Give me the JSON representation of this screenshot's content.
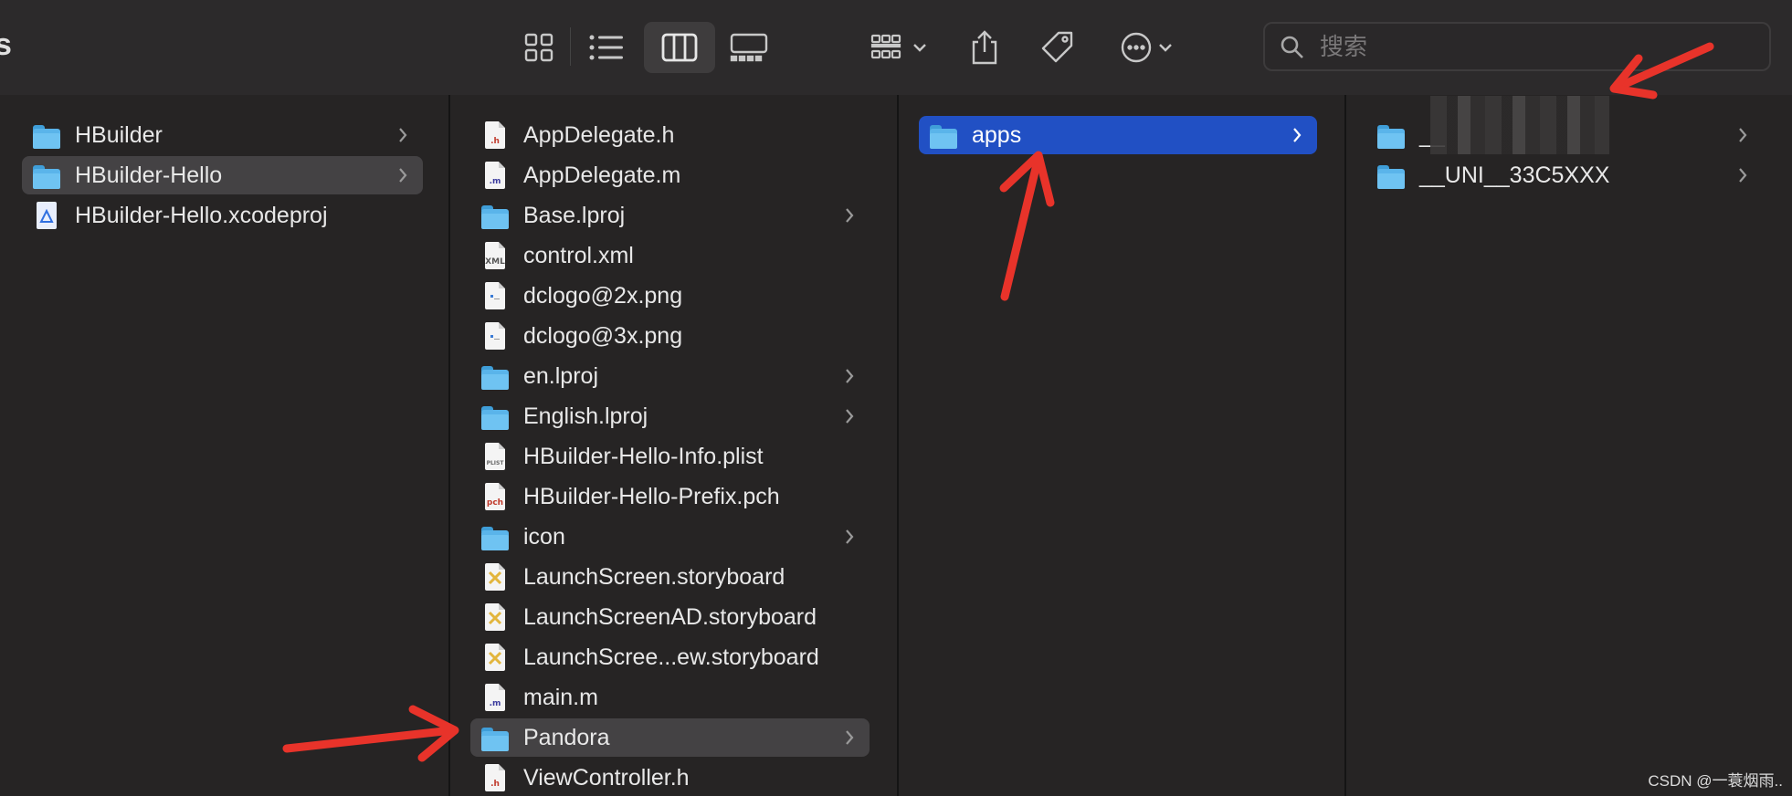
{
  "toolbar": {
    "edge_title": "s",
    "search_placeholder": "搜索",
    "buttons": [
      "icon-view",
      "list-view",
      "column-view",
      "gallery-view",
      "group",
      "share",
      "tags",
      "more"
    ]
  },
  "columns": {
    "col1": {
      "items": [
        {
          "label": "HBuilder",
          "type": "folder",
          "chevron": true
        },
        {
          "label": "HBuilder-Hello",
          "type": "folder",
          "chevron": true,
          "selected": "gray"
        },
        {
          "label": "HBuilder-Hello.xcodeproj",
          "type": "xcodeproj",
          "chevron": false
        }
      ]
    },
    "col2": {
      "items": [
        {
          "label": "AppDelegate.h",
          "type": "file",
          "ext": ".h",
          "ext_color": "#c0392b"
        },
        {
          "label": "AppDelegate.m",
          "type": "file",
          "ext": ".m",
          "ext_color": "#3b3b9e"
        },
        {
          "label": "Base.lproj",
          "type": "folder",
          "chevron": true
        },
        {
          "label": "control.xml",
          "type": "file",
          "ext": "XML",
          "ext_color": "#555555"
        },
        {
          "label": "dclogo@2x.png",
          "type": "image"
        },
        {
          "label": "dclogo@3x.png",
          "type": "image"
        },
        {
          "label": "en.lproj",
          "type": "folder",
          "chevron": true
        },
        {
          "label": "English.lproj",
          "type": "folder",
          "chevron": true
        },
        {
          "label": "HBuilder-Hello-Info.plist",
          "type": "file",
          "ext": "PLIST",
          "ext_color": "#666666"
        },
        {
          "label": "HBuilder-Hello-Prefix.pch",
          "type": "file",
          "ext": "pch",
          "ext_color": "#c0392b"
        },
        {
          "label": "icon",
          "type": "folder",
          "chevron": true
        },
        {
          "label": "LaunchScreen.storyboard",
          "type": "storyboard"
        },
        {
          "label": "LaunchScreenAD.storyboard",
          "type": "storyboard"
        },
        {
          "label": "LaunchScree...ew.storyboard",
          "type": "storyboard"
        },
        {
          "label": "main.m",
          "type": "file",
          "ext": ".m",
          "ext_color": "#3b3b9e"
        },
        {
          "label": "Pandora",
          "type": "folder",
          "chevron": true,
          "selected": "gray"
        },
        {
          "label": "ViewController.h",
          "type": "file",
          "ext": ".h",
          "ext_color": "#c0392b"
        }
      ]
    },
    "col3": {
      "items": [
        {
          "label": "apps",
          "type": "folder",
          "chevron": true,
          "selected": "blue"
        }
      ]
    },
    "col4": {
      "items": [
        {
          "label": "__",
          "type": "folder",
          "chevron": true,
          "redacted": true
        },
        {
          "label": "__UNI__33C5XXX",
          "type": "folder",
          "chevron": true
        }
      ]
    }
  },
  "watermark": "CSDN @一蓑烟雨..",
  "colors": {
    "selection_blue": "#2150c4",
    "selection_gray": "#444244",
    "arrow_red": "#e8332a",
    "folder_blue": "#5ab4ea"
  }
}
